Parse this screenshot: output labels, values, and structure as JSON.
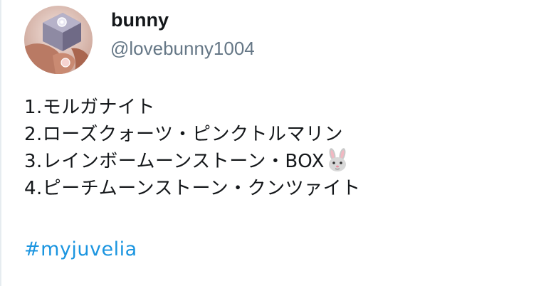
{
  "user": {
    "display_name": "bunny",
    "handle": "@lovebunny1004"
  },
  "tweet": {
    "lines": [
      "1.モルガナイト",
      "2.ローズクォーツ・ピンクトルマリン",
      "3.レインボームーンストーン・BOX",
      "4.ピーチムーンストーン・クンツァイト"
    ],
    "line3_emoji": "rabbit-face-emoji",
    "hashtag": "#myjuvelia"
  },
  "colors": {
    "name": "#14171a",
    "handle": "#657786",
    "text": "#14171a",
    "hashtag": "#1b95e0"
  }
}
